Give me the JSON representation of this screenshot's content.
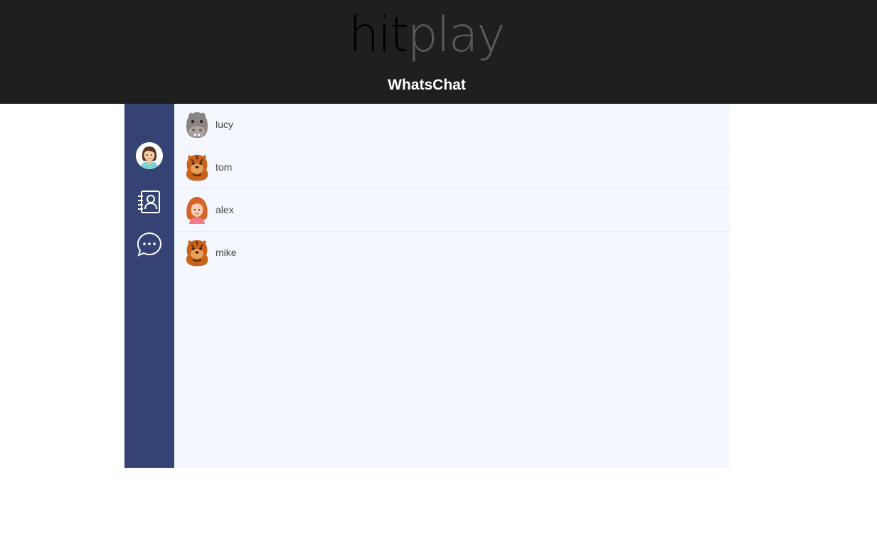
{
  "brand": {
    "logo_part1": "hit",
    "logo_part2": "play",
    "app_title": "WhatsChat"
  },
  "sidebar": {
    "profile_avatar": "woman-avatar",
    "items": [
      {
        "icon": "contacts-icon"
      },
      {
        "icon": "chat-bubble-icon"
      }
    ]
  },
  "contacts": [
    {
      "name": "lucy",
      "avatar": "hippo-avatar"
    },
    {
      "name": "tom",
      "avatar": "tiger-avatar"
    },
    {
      "name": "alex",
      "avatar": "redhead-girl-avatar"
    },
    {
      "name": "mike",
      "avatar": "tiger-avatar"
    }
  ],
  "colors": {
    "header_bg": "#1f1f1f",
    "sidebar_bg": "#344373",
    "list_bg": "#f4f7fd",
    "text": "#4a4a4a"
  }
}
